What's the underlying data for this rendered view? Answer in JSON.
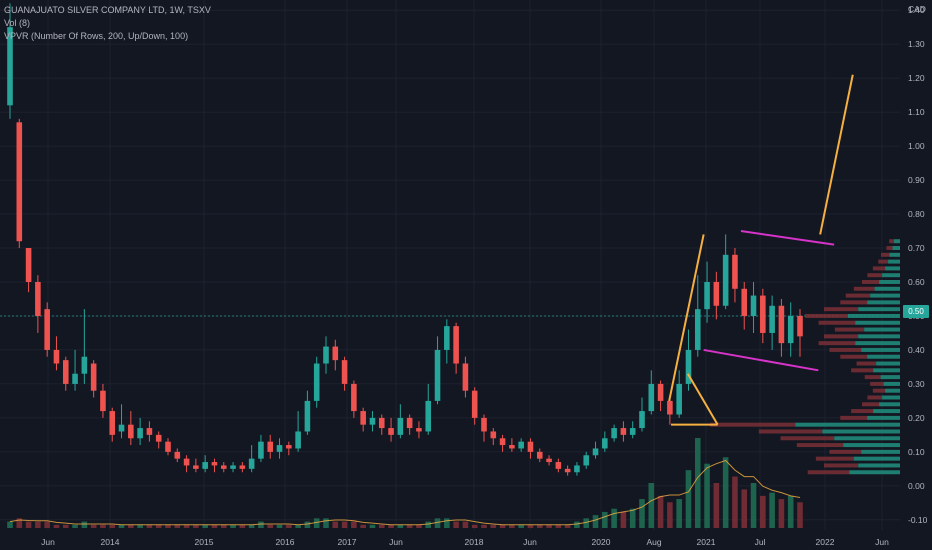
{
  "header": {
    "symbol_line": "GUANAJUATO SILVER COMPANY LTD, 1W, TSXV",
    "vol_line": "Vol (8)",
    "vpvr_line": "VPVR (Number Of Rows, 200, Up/Down, 100)"
  },
  "axis": {
    "currency": "CAD",
    "last_price_label": "0.50"
  },
  "colors": {
    "background": "#131722",
    "up": "#26a69a",
    "down": "#ef5350",
    "drawing_orange": "#f5b041",
    "drawing_magenta": "#d633c9",
    "grid": "#1e222d"
  },
  "chart_data": {
    "type": "candlestick",
    "y_ticks": [
      "1.40",
      "1.30",
      "1.20",
      "1.10",
      "1.00",
      "0.90",
      "0.80",
      "0.70",
      "0.60",
      "0.50",
      "0.40",
      "0.30",
      "0.20",
      "0.10",
      "0.00",
      "-0.10"
    ],
    "ylim": [
      -0.13,
      1.43
    ],
    "x_ticks": [
      "Jun",
      "2014",
      "2015",
      "2016",
      "2017",
      "Jun",
      "2018",
      "Jun",
      "2020",
      "Aug",
      "2021",
      "Jul",
      "2022",
      "Jun"
    ],
    "last_price": 0.5,
    "candles": [
      [
        1.12,
        1.35,
        1.08,
        1.42
      ],
      [
        1.07,
        0.72,
        0.7,
        1.08
      ],
      [
        0.7,
        0.6,
        0.57,
        0.7
      ],
      [
        0.6,
        0.5,
        0.45,
        0.62
      ],
      [
        0.52,
        0.4,
        0.38,
        0.54
      ],
      [
        0.4,
        0.36,
        0.34,
        0.44
      ],
      [
        0.37,
        0.3,
        0.28,
        0.38
      ],
      [
        0.3,
        0.33,
        0.28,
        0.4
      ],
      [
        0.33,
        0.38,
        0.3,
        0.52
      ],
      [
        0.36,
        0.28,
        0.26,
        0.37
      ],
      [
        0.28,
        0.22,
        0.2,
        0.3
      ],
      [
        0.22,
        0.15,
        0.13,
        0.23
      ],
      [
        0.16,
        0.18,
        0.14,
        0.24
      ],
      [
        0.18,
        0.14,
        0.12,
        0.22
      ],
      [
        0.14,
        0.17,
        0.12,
        0.2
      ],
      [
        0.17,
        0.15,
        0.13,
        0.19
      ],
      [
        0.15,
        0.13,
        0.11,
        0.16
      ],
      [
        0.13,
        0.1,
        0.09,
        0.14
      ],
      [
        0.1,
        0.08,
        0.07,
        0.11
      ],
      [
        0.08,
        0.06,
        0.04,
        0.09
      ],
      [
        0.06,
        0.05,
        0.04,
        0.08
      ],
      [
        0.05,
        0.07,
        0.04,
        0.09
      ],
      [
        0.07,
        0.06,
        0.04,
        0.08
      ],
      [
        0.06,
        0.05,
        0.04,
        0.07
      ],
      [
        0.05,
        0.06,
        0.04,
        0.07
      ],
      [
        0.06,
        0.05,
        0.04,
        0.07
      ],
      [
        0.05,
        0.08,
        0.04,
        0.12
      ],
      [
        0.08,
        0.13,
        0.07,
        0.15
      ],
      [
        0.13,
        0.1,
        0.08,
        0.15
      ],
      [
        0.1,
        0.12,
        0.08,
        0.14
      ],
      [
        0.12,
        0.11,
        0.09,
        0.13
      ],
      [
        0.11,
        0.16,
        0.1,
        0.22
      ],
      [
        0.16,
        0.25,
        0.15,
        0.28
      ],
      [
        0.25,
        0.36,
        0.23,
        0.38
      ],
      [
        0.36,
        0.41,
        0.33,
        0.44
      ],
      [
        0.41,
        0.37,
        0.34,
        0.43
      ],
      [
        0.37,
        0.3,
        0.28,
        0.38
      ],
      [
        0.3,
        0.22,
        0.2,
        0.31
      ],
      [
        0.22,
        0.18,
        0.16,
        0.23
      ],
      [
        0.18,
        0.2,
        0.16,
        0.22
      ],
      [
        0.2,
        0.17,
        0.15,
        0.21
      ],
      [
        0.17,
        0.15,
        0.13,
        0.2
      ],
      [
        0.15,
        0.2,
        0.14,
        0.24
      ],
      [
        0.2,
        0.17,
        0.15,
        0.21
      ],
      [
        0.17,
        0.16,
        0.14,
        0.19
      ],
      [
        0.16,
        0.25,
        0.15,
        0.3
      ],
      [
        0.25,
        0.4,
        0.24,
        0.44
      ],
      [
        0.4,
        0.47,
        0.36,
        0.49
      ],
      [
        0.47,
        0.36,
        0.33,
        0.48
      ],
      [
        0.36,
        0.28,
        0.26,
        0.38
      ],
      [
        0.28,
        0.2,
        0.18,
        0.29
      ],
      [
        0.2,
        0.16,
        0.13,
        0.21
      ],
      [
        0.16,
        0.14,
        0.12,
        0.17
      ],
      [
        0.14,
        0.12,
        0.1,
        0.15
      ],
      [
        0.12,
        0.11,
        0.1,
        0.14
      ],
      [
        0.11,
        0.13,
        0.1,
        0.14
      ],
      [
        0.13,
        0.1,
        0.08,
        0.14
      ],
      [
        0.1,
        0.08,
        0.07,
        0.11
      ],
      [
        0.08,
        0.07,
        0.06,
        0.09
      ],
      [
        0.07,
        0.05,
        0.04,
        0.08
      ],
      [
        0.05,
        0.04,
        0.03,
        0.06
      ],
      [
        0.04,
        0.06,
        0.03,
        0.07
      ],
      [
        0.06,
        0.09,
        0.05,
        0.1
      ],
      [
        0.09,
        0.11,
        0.08,
        0.13
      ],
      [
        0.11,
        0.14,
        0.1,
        0.16
      ],
      [
        0.14,
        0.17,
        0.13,
        0.18
      ],
      [
        0.17,
        0.15,
        0.13,
        0.19
      ],
      [
        0.15,
        0.17,
        0.14,
        0.19
      ],
      [
        0.17,
        0.22,
        0.16,
        0.26
      ],
      [
        0.22,
        0.3,
        0.21,
        0.34
      ],
      [
        0.3,
        0.25,
        0.22,
        0.31
      ],
      [
        0.25,
        0.21,
        0.18,
        0.26
      ],
      [
        0.21,
        0.3,
        0.2,
        0.34
      ],
      [
        0.3,
        0.4,
        0.28,
        0.46
      ],
      [
        0.4,
        0.52,
        0.38,
        0.62
      ],
      [
        0.52,
        0.6,
        0.48,
        0.66
      ],
      [
        0.6,
        0.53,
        0.49,
        0.63
      ],
      [
        0.53,
        0.68,
        0.52,
        0.74
      ],
      [
        0.68,
        0.58,
        0.54,
        0.7
      ],
      [
        0.58,
        0.5,
        0.46,
        0.6
      ],
      [
        0.5,
        0.56,
        0.45,
        0.6
      ],
      [
        0.56,
        0.45,
        0.42,
        0.58
      ],
      [
        0.45,
        0.53,
        0.4,
        0.56
      ],
      [
        0.53,
        0.42,
        0.38,
        0.55
      ],
      [
        0.42,
        0.5,
        0.38,
        0.54
      ],
      [
        0.5,
        0.44,
        0.38,
        0.52
      ]
    ],
    "volume": [
      2,
      3,
      2,
      2,
      2,
      1,
      1,
      1,
      2,
      1,
      1,
      1,
      1,
      1,
      1,
      1,
      1,
      1,
      1,
      1,
      1,
      1,
      1,
      1,
      1,
      1,
      1,
      2,
      1,
      1,
      1,
      1,
      2,
      3,
      3,
      2,
      2,
      2,
      1,
      1,
      1,
      1,
      1,
      1,
      1,
      2,
      3,
      3,
      2,
      2,
      1,
      1,
      1,
      1,
      1,
      1,
      1,
      1,
      1,
      1,
      1,
      2,
      3,
      4,
      5,
      6,
      5,
      6,
      9,
      14,
      10,
      8,
      9,
      18,
      28,
      20,
      14,
      22,
      16,
      12,
      14,
      10,
      11,
      9,
      10,
      8
    ],
    "vpvr": [
      [
        0.04,
        34
      ],
      [
        0.06,
        28
      ],
      [
        0.08,
        31
      ],
      [
        0.1,
        26
      ],
      [
        0.12,
        38
      ],
      [
        0.14,
        44
      ],
      [
        0.16,
        52
      ],
      [
        0.18,
        70
      ],
      [
        0.2,
        22
      ],
      [
        0.22,
        18
      ],
      [
        0.24,
        14
      ],
      [
        0.26,
        12
      ],
      [
        0.28,
        10
      ],
      [
        0.3,
        11
      ],
      [
        0.32,
        13
      ],
      [
        0.34,
        18
      ],
      [
        0.36,
        16
      ],
      [
        0.38,
        22
      ],
      [
        0.4,
        26
      ],
      [
        0.42,
        30
      ],
      [
        0.44,
        28
      ],
      [
        0.46,
        24
      ],
      [
        0.48,
        30
      ],
      [
        0.5,
        35
      ],
      [
        0.52,
        28
      ],
      [
        0.54,
        22
      ],
      [
        0.56,
        20
      ],
      [
        0.58,
        17
      ],
      [
        0.6,
        14
      ],
      [
        0.62,
        12
      ],
      [
        0.64,
        10
      ],
      [
        0.66,
        8
      ],
      [
        0.68,
        7
      ],
      [
        0.7,
        5
      ],
      [
        0.72,
        4
      ]
    ],
    "drawings": [
      {
        "type": "line",
        "color": "orange",
        "from": [
          0.718,
          0.25
        ],
        "to": [
          0.755,
          0.74
        ]
      },
      {
        "type": "line",
        "color": "orange",
        "from": [
          0.88,
          0.74
        ],
        "to": [
          0.915,
          1.21
        ]
      },
      {
        "type": "line",
        "color": "orange",
        "from": [
          0.738,
          0.33
        ],
        "to": [
          0.77,
          0.18
        ]
      },
      {
        "type": "line",
        "color": "magenta",
        "from": [
          0.795,
          0.75
        ],
        "to": [
          0.895,
          0.71
        ]
      },
      {
        "type": "line",
        "color": "magenta",
        "from": [
          0.755,
          0.4
        ],
        "to": [
          0.878,
          0.34
        ]
      },
      {
        "type": "line",
        "color": "orange",
        "from": [
          0.72,
          0.18
        ],
        "to": [
          0.77,
          0.18
        ]
      }
    ]
  }
}
